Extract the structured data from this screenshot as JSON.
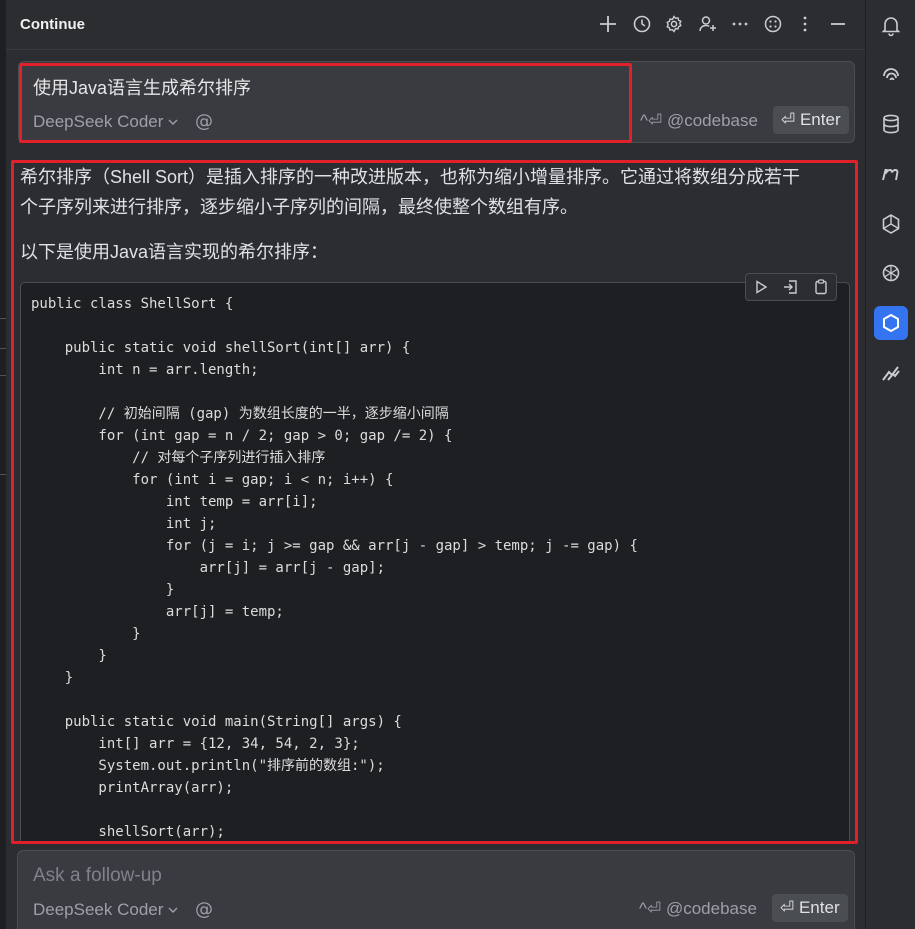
{
  "header": {
    "title": "Continue"
  },
  "query": {
    "text": "使用Java语言生成希尔排序",
    "model": "DeepSeek Coder",
    "at_symbol": "@",
    "codebase": "^⏎ @codebase",
    "enter": "⏎ Enter"
  },
  "response": {
    "para1_line1": "希尔排序（Shell Sort）是插入排序的一种改进版本，也称为缩小增量排序。它通过将数组分成若干",
    "para1_line2": "个子序列来进行排序，逐步缩小子序列的间隔，最终使整个数组有序。",
    "para2": "以下是使用Java语言实现的希尔排序：",
    "code_lines": [
      "public class ShellSort {",
      "",
      "    public static void shellSort(int[] arr) {",
      "        int n = arr.length;",
      "",
      "        // 初始间隔 (gap) 为数组长度的一半，逐步缩小间隔",
      "        for (int gap = n / 2; gap > 0; gap /= 2) {",
      "            // 对每个子序列进行插入排序",
      "            for (int i = gap; i < n; i++) {",
      "                int temp = arr[i];",
      "                int j;",
      "                for (j = i; j >= gap && arr[j - gap] > temp; j -= gap) {",
      "                    arr[j] = arr[j - gap];",
      "                }",
      "                arr[j] = temp;",
      "            }",
      "        }",
      "    }",
      "",
      "    public static void main(String[] args) {",
      "        int[] arr = {12, 34, 54, 2, 3};",
      "        System.out.println(\"排序前的数组:\");",
      "        printArray(arr);",
      "",
      "        shellSort(arr);"
    ]
  },
  "followup": {
    "placeholder": "Ask a follow-up",
    "model": "DeepSeek Coder",
    "at_symbol": "@",
    "codebase": "^⏎ @codebase",
    "enter": "⏎ Enter"
  },
  "colors": {
    "panel_bg": "#2b2d30",
    "input_bg": "#393b40",
    "code_bg": "#1e1f22",
    "highlight_red": "#e0202a",
    "active_blue": "#3574f0"
  }
}
